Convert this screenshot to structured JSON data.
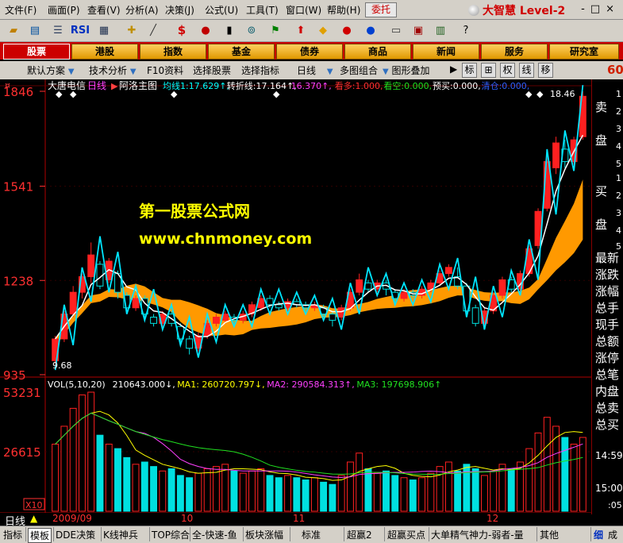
{
  "menu": {
    "items": [
      "文件(F)",
      "画面(P)",
      "查看(V)",
      "分析(A)",
      "决策(J)",
      "公式(U)",
      "工具(T)",
      "窗口(W)",
      "帮助(H)"
    ],
    "weituo": "委托",
    "brand": "大智慧 Level-2",
    "window_buttons": "-□×"
  },
  "toolbar": {
    "icons": [
      "folder-open-icon",
      "chart-window-icon",
      "stock-list-icon",
      "rsi-indicator-icon",
      "grid-icon",
      "crosshair-icon",
      "draw-line-icon",
      "finance-dollar-icon",
      "traffic-light-icon",
      "bars-icon",
      "binoculars-icon",
      "flag-icon",
      "up-arrow-box-icon",
      "diamond-warning-icon",
      "red-ball-icon",
      "blue-ball-icon",
      "notepad-icon",
      "calendar-icon",
      "books-icon",
      "help-icon"
    ],
    "rsi_label": "RSI",
    "dollar_label": "$"
  },
  "categories": [
    "股票",
    "港股",
    "指数",
    "基金",
    "债券",
    "商品",
    "新闻",
    "服务",
    "研究室"
  ],
  "funcbar": {
    "items": [
      "默认方案",
      "技术分析",
      "F10资料",
      "选择股票",
      "选择指标",
      "日线",
      "多图组合",
      "图形叠加"
    ],
    "square_buttons": [
      "标",
      "⊞",
      "权",
      "线",
      "移"
    ],
    "right_number": "60"
  },
  "stock": {
    "name": "大唐电信",
    "period": "日线",
    "template": "阿洛主图",
    "indicators": [
      {
        "label": "均线1:",
        "value": "17.629",
        "arrow": "↑",
        "color": "#00ffff"
      },
      {
        "label": "转折线:",
        "value": "17.164",
        "arrow": "↑",
        "color": "#ffffff"
      },
      {
        "label": "",
        "value": "16.370",
        "arrow": "↑",
        "color": "#ff40ff"
      },
      {
        "label": "看多:",
        "value": "1.000",
        "arrow": "",
        "color": "#ff3030"
      },
      {
        "label": "看空:",
        "value": "0.000",
        "arrow": "",
        "color": "#20e020"
      },
      {
        "label": "预买:",
        "value": "0.000",
        "arrow": "",
        "color": "#ffffff"
      },
      {
        "label": "清仓:",
        "value": "0.000",
        "arrow": "",
        "color": "#3060ff"
      }
    ],
    "price_axis": [
      "1846",
      "1541",
      "1238",
      "935"
    ],
    "max_label": "18.46",
    "min_label": "9.68",
    "watermark_title": "第一股票公式网",
    "watermark_url": "www.chnmoney.com"
  },
  "volume": {
    "header": [
      {
        "text": "VOL(5,10,20)",
        "color": "#ffffff"
      },
      {
        "text": "210643.000↓,",
        "color": "#ffffff"
      },
      {
        "text": "MA1: 260720.797↓,",
        "color": "#ffff00"
      },
      {
        "text": "MA2: 290584.313↑,",
        "color": "#ff40ff"
      },
      {
        "text": "MA3: 197698.906↑",
        "color": "#20e020"
      }
    ],
    "axis": [
      "53231",
      "26615"
    ],
    "unit": "X10"
  },
  "date_axis": [
    "2009/09",
    "10",
    "11",
    "12"
  ],
  "period_label": "日线",
  "right_side": {
    "top": [
      "卖",
      "盘"
    ],
    "top_nums": [
      "1",
      "2",
      "3",
      "4",
      "5"
    ],
    "mid": [
      "买",
      "盘"
    ],
    "mid_nums": [
      "1",
      "2",
      "3",
      "4",
      "5"
    ],
    "list": [
      "最新",
      "涨跌",
      "涨幅",
      "总手",
      "现手",
      "总额",
      "涨停",
      "总笔",
      "内盘",
      "总卖",
      "总买"
    ],
    "times": [
      "14:59",
      "15:00",
      ":05"
    ],
    "bottom": [
      "细",
      "成"
    ]
  },
  "bottom_tabs": [
    "指标",
    "模板",
    "DDE决策",
    "K线神兵",
    "TOP综合",
    "全-快速-鱼",
    "板块涨幅",
    "标准",
    "超赢2",
    "超赢买点",
    "大单精气神力-弱者-量",
    "其他"
  ],
  "colors": {
    "up": "#ff2020",
    "down": "#00e0e0",
    "ma_cyan": "#00e5ff",
    "band": "#ff9900"
  },
  "chart_data": {
    "type": "candlestick",
    "price_range": [
      9.35,
      18.46
    ],
    "volume_range": [
      0,
      53231
    ],
    "candles": [
      [
        9.8,
        10.5,
        9.6,
        10.6
      ],
      [
        10.5,
        11.3,
        10.4,
        11.4
      ],
      [
        11.3,
        12.0,
        11.2,
        12.2
      ],
      [
        12.0,
        12.5,
        11.8,
        12.6
      ],
      [
        12.5,
        13.2,
        12.3,
        13.6
      ],
      [
        12.9,
        12.2,
        12.1,
        13.0
      ],
      [
        12.4,
        13.0,
        12.3,
        13.1
      ],
      [
        12.6,
        12.0,
        11.8,
        12.7
      ],
      [
        11.9,
        11.5,
        11.4,
        12.0
      ],
      [
        11.5,
        11.8,
        11.4,
        11.9
      ],
      [
        11.8,
        11.3,
        11.2,
        11.9
      ],
      [
        11.2,
        11.0,
        10.9,
        11.3
      ],
      [
        11.0,
        11.3,
        10.9,
        11.4
      ],
      [
        11.3,
        11.0,
        10.9,
        11.4
      ],
      [
        10.9,
        10.5,
        10.4,
        11.0
      ],
      [
        10.5,
        10.2,
        10.0,
        10.6
      ],
      [
        10.2,
        10.6,
        10.1,
        10.7
      ],
      [
        10.6,
        11.0,
        10.5,
        11.1
      ],
      [
        11.0,
        11.2,
        10.9,
        11.3
      ],
      [
        11.1,
        11.3,
        11.0,
        11.4
      ],
      [
        11.2,
        11.1,
        11.0,
        11.3
      ],
      [
        11.1,
        11.3,
        11.0,
        11.4
      ],
      [
        11.3,
        11.6,
        11.2,
        11.7
      ],
      [
        11.5,
        11.8,
        11.4,
        11.9
      ],
      [
        11.8,
        11.6,
        11.5,
        11.9
      ],
      [
        11.6,
        11.5,
        11.4,
        11.7
      ],
      [
        11.5,
        11.7,
        11.4,
        11.8
      ],
      [
        11.7,
        11.6,
        11.5,
        11.8
      ],
      [
        11.6,
        11.5,
        11.4,
        11.7
      ],
      [
        11.5,
        11.6,
        11.4,
        11.7
      ],
      [
        11.5,
        11.3,
        11.2,
        11.6
      ],
      [
        11.3,
        11.1,
        10.9,
        11.4
      ],
      [
        11.2,
        11.5,
        11.1,
        11.6
      ],
      [
        11.5,
        12.0,
        11.4,
        12.1
      ],
      [
        12.0,
        12.4,
        11.9,
        12.6
      ],
      [
        12.3,
        12.1,
        12.0,
        12.4
      ],
      [
        12.1,
        12.3,
        12.0,
        12.4
      ],
      [
        12.3,
        12.1,
        11.9,
        12.4
      ],
      [
        12.0,
        11.8,
        11.7,
        12.1
      ],
      [
        11.8,
        12.0,
        11.7,
        12.1
      ],
      [
        12.0,
        11.9,
        11.8,
        12.1
      ],
      [
        11.9,
        12.1,
        11.8,
        12.2
      ],
      [
        12.1,
        12.3,
        12.0,
        12.4
      ],
      [
        12.3,
        12.6,
        12.2,
        12.7
      ],
      [
        12.6,
        12.8,
        12.5,
        12.9
      ],
      [
        12.5,
        12.2,
        12.1,
        12.8
      ],
      [
        12.2,
        11.4,
        11.3,
        12.3
      ],
      [
        11.5,
        11.0,
        10.9,
        11.6
      ],
      [
        11.0,
        11.4,
        10.9,
        11.5
      ],
      [
        11.4,
        11.9,
        11.3,
        12.0
      ],
      [
        11.9,
        12.4,
        11.8,
        12.5
      ],
      [
        12.4,
        12.1,
        12.0,
        12.5
      ],
      [
        12.1,
        12.6,
        12.0,
        12.7
      ],
      [
        12.6,
        13.4,
        12.5,
        13.5
      ],
      [
        13.5,
        14.6,
        13.4,
        14.7
      ],
      [
        14.7,
        16.2,
        14.6,
        16.4
      ],
      [
        16.0,
        16.8,
        15.8,
        17.0
      ],
      [
        16.6,
        16.2,
        16.0,
        16.9
      ],
      [
        16.2,
        16.9,
        16.1,
        17.0
      ],
      [
        17.0,
        18.3,
        16.9,
        18.46
      ]
    ],
    "volumes": [
      30000,
      38000,
      46000,
      52000,
      53231,
      34000,
      30000,
      28000,
      24000,
      21000,
      22000,
      20000,
      18000,
      19000,
      16000,
      15000,
      17000,
      19000,
      20000,
      21000,
      18000,
      17000,
      18000,
      19000,
      16000,
      15000,
      16000,
      15000,
      14000,
      15000,
      13000,
      12000,
      16000,
      22000,
      26000,
      19000,
      17000,
      18000,
      16000,
      15000,
      14000,
      15000,
      17000,
      20000,
      22000,
      18000,
      21000,
      19000,
      16000,
      18000,
      21000,
      19000,
      22000,
      28000,
      35000,
      42000,
      38000,
      33000,
      30000,
      33000
    ]
  }
}
